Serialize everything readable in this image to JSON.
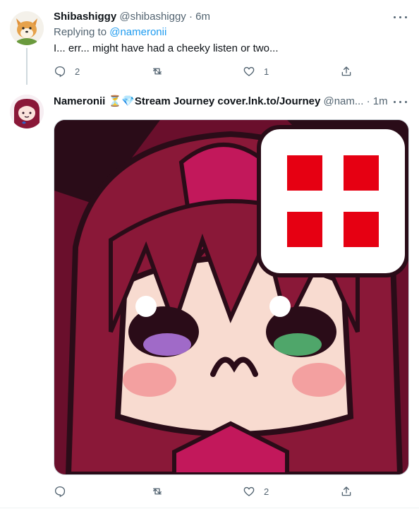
{
  "tweets": [
    {
      "name": "Shibashiggy",
      "handle": "@shibashiggy",
      "separator": "·",
      "time": "6m",
      "replying_prefix": "Replying to ",
      "replying_to": "@nameronii",
      "text": "I... err... might have had a cheeky listen or two...",
      "actions": {
        "reply_count": "2",
        "retweet_count": "",
        "like_count": "1"
      }
    },
    {
      "name": "Nameronii ⏳💎Stream Journey cover.lnk.to/Journey",
      "handle": "@nam...",
      "separator": "·",
      "time": "1m",
      "actions": {
        "reply_count": "",
        "retweet_count": "",
        "like_count": "2"
      }
    }
  ],
  "icons": {
    "reply": "reply-icon",
    "retweet": "retweet-icon",
    "like": "heart-icon",
    "share": "share-icon",
    "more": "more-icon"
  },
  "colors": {
    "link": "#1d9bf0",
    "secondary_text": "#536471",
    "anger_mark": "#e60012",
    "hair": "#8a1838"
  }
}
